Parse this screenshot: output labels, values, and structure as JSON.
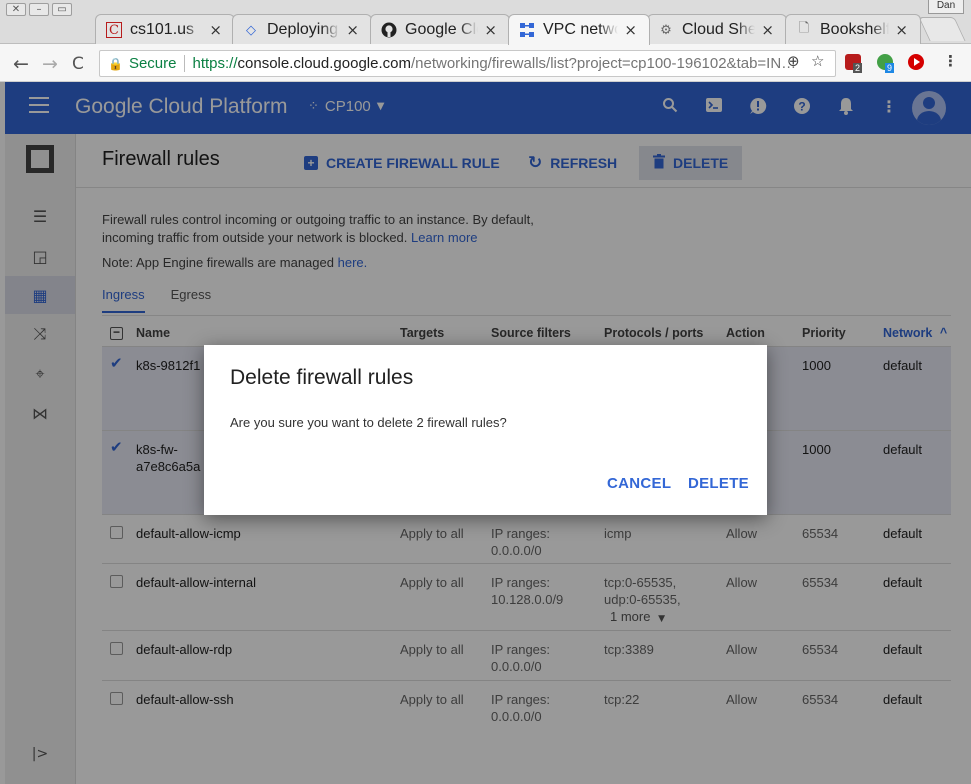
{
  "browser": {
    "profile_label": "Dan",
    "tabs": [
      {
        "label": "cs101.us",
        "icon": "c-favicon"
      },
      {
        "label": "Deploying App",
        "icon": "deploy-favicon"
      },
      {
        "label": "Google Cloud",
        "icon": "github-favicon"
      },
      {
        "label": "VPC networks",
        "icon": "vpc-favicon"
      },
      {
        "label": "Cloud Shell",
        "icon": "cloudshell-favicon"
      },
      {
        "label": "Bookshelf - Python",
        "icon": "page-favicon"
      }
    ],
    "secure_label": "Secure",
    "url_scheme": "https://",
    "url_host": "console.cloud.google.com",
    "url_path": "/networking/firewalls/list?project=cp100-196102&tab=IN…",
    "extensions": [
      {
        "name": "ublock-extension",
        "badge": "2",
        "color": "#b71c1c"
      },
      {
        "name": "green-extension",
        "badge": "9",
        "color": "#43a047"
      },
      {
        "name": "video-extension",
        "badge": "",
        "color": "#d50000"
      }
    ]
  },
  "header": {
    "title": "Google Cloud Platform",
    "project": "CP100",
    "accent": "#3367d6"
  },
  "page": {
    "title": "Firewall rules",
    "create_label": "CREATE FIREWALL RULE",
    "refresh_label": "REFRESH",
    "delete_label": "DELETE",
    "desc_text": "Firewall rules control incoming or outgoing traffic to an instance. By default, incoming traffic from outside your network is blocked.",
    "learn_more": "Learn more",
    "note_text": "Note: App Engine firewalls are managed",
    "note_link": "here.",
    "tab_ingress": "Ingress",
    "tab_egress": "Egress"
  },
  "table": {
    "headers": {
      "name": "Name",
      "targets": "Targets",
      "source": "Source filters",
      "protocols": "Protocols / ports",
      "action": "Action",
      "priority": "Priority",
      "network": "Network",
      "sort_indicator": "^"
    },
    "rows": [
      {
        "name": "k8s-9812f1",
        "targets": "",
        "source": "",
        "protocols": "",
        "action": "",
        "priority": "1000",
        "network": "default",
        "checked": true
      },
      {
        "name": "k8s-fw-a7e8c6a5a",
        "targets": "",
        "source": "",
        "protocols": "",
        "action": "",
        "priority": "1000",
        "network": "default",
        "checked": true
      },
      {
        "name": "default-allow-icmp",
        "targets": "Apply to all",
        "source": "IP ranges: 0.0.0.0/0",
        "protocols": "icmp",
        "action": "Allow",
        "priority": "65534",
        "network": "default",
        "checked": false
      },
      {
        "name": "default-allow-internal",
        "targets": "Apply to all",
        "source": "IP ranges: 10.128.0.0/9",
        "protocols": "tcp:0-65535, udp:0-65535,",
        "more": "1 more",
        "action": "Allow",
        "priority": "65534",
        "network": "default",
        "checked": false
      },
      {
        "name": "default-allow-rdp",
        "targets": "Apply to all",
        "source": "IP ranges: 0.0.0.0/0",
        "protocols": "tcp:3389",
        "action": "Allow",
        "priority": "65534",
        "network": "default",
        "checked": false
      },
      {
        "name": "default-allow-ssh",
        "targets": "Apply to all",
        "source": "IP ranges: 0.0.0.0/0",
        "protocols": "tcp:22",
        "action": "Allow",
        "priority": "65534",
        "network": "default",
        "checked": false
      }
    ]
  },
  "dialog": {
    "title": "Delete firewall rules",
    "message": "Are you sure you want to delete 2 firewall rules?",
    "cancel_label": "CANCEL",
    "delete_label": "DELETE"
  }
}
